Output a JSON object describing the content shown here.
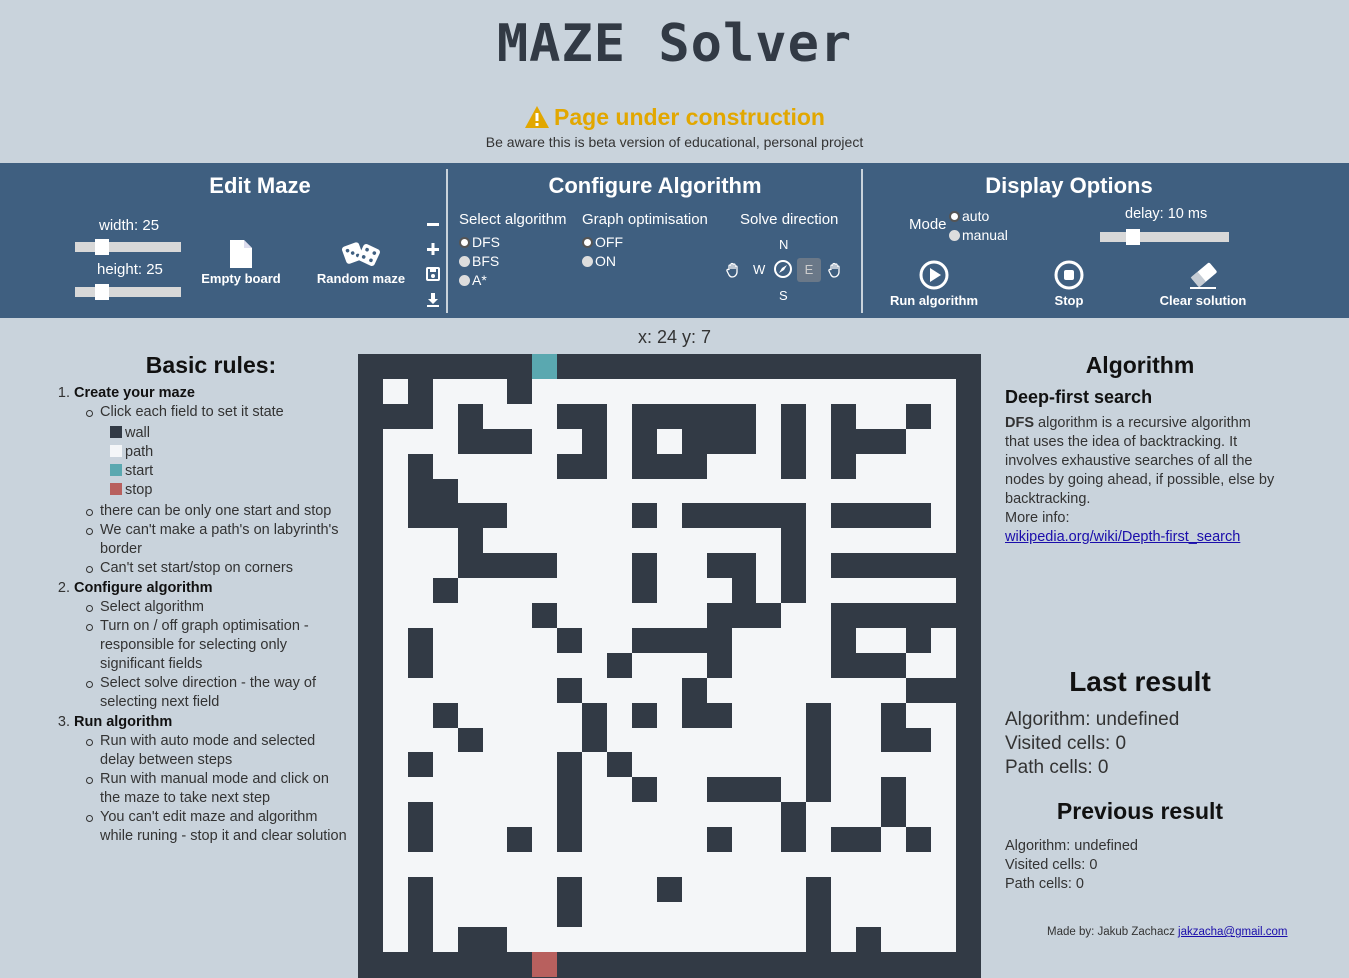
{
  "header": {
    "title": "MAZE Solver",
    "warning": "Page under construction",
    "subtitle": "Be aware this is beta version of educational, personal project"
  },
  "edit": {
    "title": "Edit Maze",
    "width_label": "width: 25",
    "height_label": "height: 25",
    "width_level": 0.22,
    "height_level": 0.22,
    "empty_board": "Empty board",
    "random_maze": "Random maze"
  },
  "configure": {
    "title": "Configure Algorithm",
    "select_label": "Select algorithm",
    "algorithms": [
      "DFS",
      "BFS",
      "A*"
    ],
    "selected_algorithm": "DFS",
    "graph_label": "Graph optimisation",
    "graph_options": [
      "OFF",
      "ON"
    ],
    "selected_graph": "OFF",
    "direction_label": "Solve direction",
    "dir_n": "N",
    "dir_w": "W",
    "dir_e": "E",
    "dir_s": "S"
  },
  "display": {
    "title": "Display Options",
    "mode_label": "Mode",
    "modes": [
      "auto",
      "manual"
    ],
    "selected_mode": "auto",
    "delay_label": "delay: 10 ms",
    "delay_level": 0.23,
    "run": "Run algorithm",
    "stop": "Stop",
    "clear": "Clear solution"
  },
  "coords": "x: 24 y: 7",
  "rules": {
    "title": "Basic rules:",
    "step1": "Create your maze",
    "step1_items": [
      "Click each field to set it state"
    ],
    "legend": [
      "wall",
      "path",
      "start",
      "stop"
    ],
    "step1_more": [
      "there can be only one start and stop",
      "We can't make a path's on labyrinth's border",
      "Can't set start/stop on corners"
    ],
    "step2": "Configure algorithm",
    "step2_items": [
      "Select algorithm",
      "Turn on / off graph optimisation - responsible for selecting only significant fields",
      "Select solve direction - the way of selecting next field"
    ],
    "step3": "Run algorithm",
    "step3_items": [
      "Run with auto mode and selected delay between steps",
      "Run with manual mode and click on the maze to take next step",
      "You can't edit maze and algorithm while runing - stop it and clear solution"
    ]
  },
  "algorithm": {
    "title": "Algorithm",
    "name": "Deep-first search",
    "abbr": "DFS",
    "desc": " algorithm is a recursive algorithm that uses the idea of backtracking. It involves exhaustive searches of all the nodes by going ahead, if possible, else by backtracking.",
    "more": "More info:",
    "link": "wikipedia.org/wiki/Depth-first_search"
  },
  "last_result": {
    "title": "Last result",
    "algorithm": "Algorithm: undefined",
    "visited": "Visited cells: 0",
    "path": "Path cells: 0"
  },
  "previous_result": {
    "title": "Previous result",
    "algorithm": "Algorithm: undefined",
    "visited": "Visited cells: 0",
    "path": "Path cells: 0"
  },
  "credits": {
    "text": "Made by: Jakub Zachacz ",
    "email": "jakzacha@gmail.com"
  },
  "colors": {
    "wall": "#323a45",
    "path": "#f4f6f8",
    "start": "#5aa8b0",
    "stop": "#b8605e",
    "toolbar": "#3f5f80",
    "warning": "#e2a700"
  },
  "maze": [
    "WWWWWWWSWWWWWWWWWWWWWWWWW",
    "WPWPPPWPPPPPPPPPPPPPPPPPW",
    "WWWPWPPPWWPWWWWWPWPWPPWPW",
    "WPPPWWWPPWPWPWWWPWPWWWPPW",
    "WPWPPPPPWWPWWWPPPWPWPPPPW",
    "WPWWPPPPPPPPPPPPPPPPPPPPW",
    "WPWWWWPPPPPWPWWWWWPWWWWPW",
    "WPPPWPPPPPPPPPPPPWPPPPPPW",
    "WPPPWWWWPPPWPPWWPWPWWWWWW",
    "WPPWPPPPPPPWPPPWPWPPPPPPW",
    "WPPPPPPWPPPPPPWWWPPWWWWWW",
    "WPWPPPPPWPPWWWWPPPPWPPWPW",
    "WPWPPPPPPPWPPPWPPPPWWWPPW",
    "WPPPPPPPWPPPPWPPPPPPPPWWW",
    "WPPWPPPPPWPWPWWPPPWPPWPPW",
    "WPPPWPPPPWPPPPPPPPWPPWWPW",
    "WPWPPPPPWPWPPPPPPPWPPPPPW",
    "WPPPPPPPWPPWPPWWWPWPPWPPW",
    "WPWPPPPPWPPPPPPPPWPPPWPPW",
    "WPWPPPWPWPPPPPWPPWPWWPWPW",
    "WPPPPPPPPPPPPPPPPPPPPPPPW",
    "WPWPPPPPWPPPWPPPPPWPPPPPW",
    "WPWPPPPPWPPPPPPPPPWPPPPPW",
    "WPWPWWPPPPPPPPPPPPWPWPPPW",
    "WWWWWWWXWWWWWWWWWWWWWWWWW"
  ]
}
